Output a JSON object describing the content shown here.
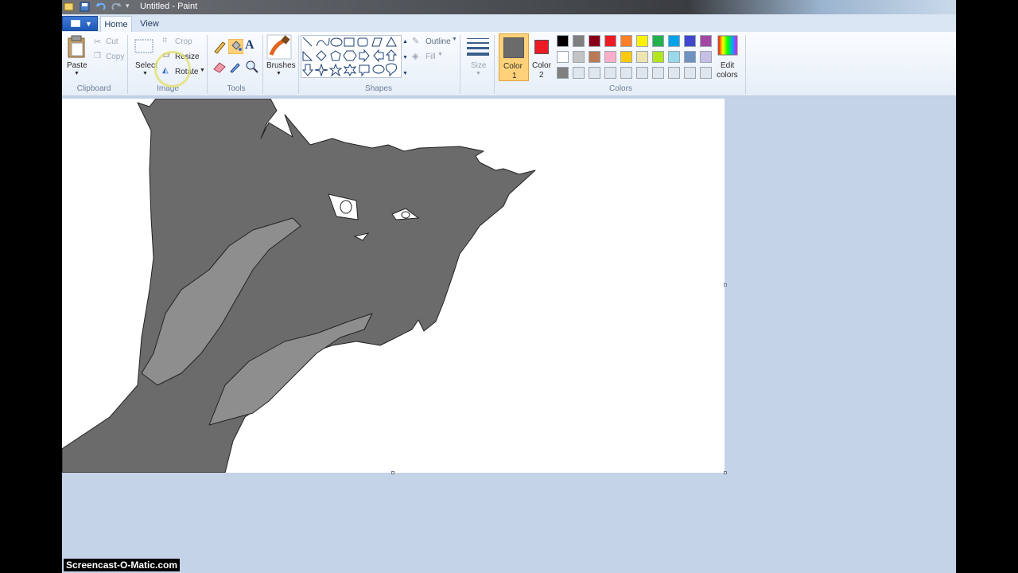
{
  "window": {
    "title": "Untitled - Paint"
  },
  "tabs": {
    "home": "Home",
    "view": "View"
  },
  "clipboard": {
    "paste": "Paste",
    "cut": "Cut",
    "copy": "Copy",
    "label": "Clipboard"
  },
  "image": {
    "select": "Select",
    "crop": "Crop",
    "resize": "Resize",
    "rotate": "Rotate",
    "label": "Image"
  },
  "tools": {
    "label": "Tools",
    "text_glyph": "A"
  },
  "brushes": {
    "label": "Brushes"
  },
  "shapes": {
    "label": "Shapes",
    "outline": "Outline",
    "fill": "Fill"
  },
  "size": {
    "label": "Size"
  },
  "colors": {
    "label": "Colors",
    "color1_label": "Color",
    "color1_num": "1",
    "color2_label": "Color",
    "color2_num": "2",
    "color1_value": "#6b6b6b",
    "color2_value": "#ed1c24",
    "edit_line1": "Edit",
    "edit_line2": "colors",
    "palette": [
      "#000000",
      "#7f7f7f",
      "#880015",
      "#ed1c24",
      "#ff7f27",
      "#fff200",
      "#22b14c",
      "#00a2e8",
      "#3f48cc",
      "#a349a4",
      "#ffffff",
      "#c3c3c3",
      "#b97a57",
      "#ffaec9",
      "#ffc90e",
      "#efe4b0",
      "#b5e61d",
      "#99d9ea",
      "#7092be",
      "#c8bfe7",
      "#808080",
      "#dfe6ee",
      "#dfe6ee",
      "#dfe6ee",
      "#dfe6ee",
      "#dfe6ee",
      "#dfe6ee",
      "#dfe6ee",
      "#dfe6ee",
      "#dfe6ee"
    ]
  },
  "drawing": {
    "fur_dark": "#6b6b6b",
    "fur_light": "#8e8e8e",
    "outline": "#222222"
  },
  "watermark": "Screencast-O-Matic.com"
}
